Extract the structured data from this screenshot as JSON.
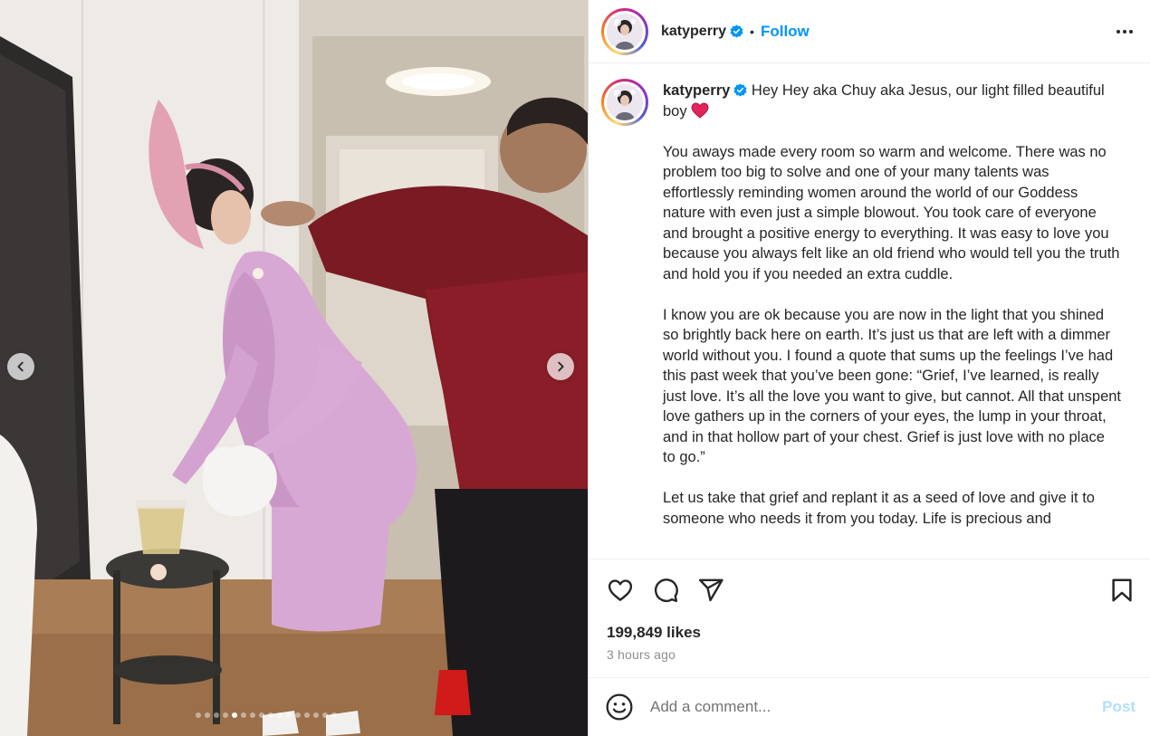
{
  "post": {
    "username": "katyperry",
    "verified": true,
    "separator": "•",
    "follow_label": "Follow",
    "more_icon": "more-horizontal-icon"
  },
  "media": {
    "prev_icon": "chevron-left-icon",
    "next_icon": "chevron-right-icon",
    "slide_count": 16,
    "active_slide": 5
  },
  "caption": {
    "username": "katyperry",
    "first_line": "Hey Hey aka Chuy aka Jesus, our light filled beautiful boy",
    "heart_emoji": "red-heart-icon",
    "paragraphs": [
      "You aways made every room so warm and welcome. There was no problem too big to solve and one of your many talents was effortlessly reminding women around the world of our Goddess nature with even just a simple blowout. You took care of everyone and brought a positive energy to everything. It was easy to love you because you always felt like an old friend who would tell you the truth and hold you if you needed an extra cuddle.",
      "I know you are ok because you are now in the light that you shined so brightly back here on earth. It’s just us that are left with a dimmer world without you. I found a quote that sums up the feelings I’ve had this past week that you’ve been gone: “Grief, I’ve learned, is really just love. It’s all the love you want to give, but cannot. All that unspent love gathers up in the corners of your eyes, the lump in your throat, and in that hollow part of your chest. Grief is just love with no place to go.”",
      "Let us take that grief and replant it as a seed of love and give it to someone who needs it from you today. Life is precious and"
    ]
  },
  "actions": {
    "like_icon": "heart-outline-icon",
    "comment_icon": "comment-bubble-icon",
    "share_icon": "paper-plane-icon",
    "save_icon": "bookmark-icon",
    "likes": "199,849 likes",
    "timestamp": "3 hours ago"
  },
  "comment": {
    "emoji_icon": "smiley-face-icon",
    "placeholder": "Add a comment...",
    "post_label": "Post"
  },
  "colors": {
    "accent": "#0095f6",
    "post_disabled": "#b2dffc",
    "verified": "#0095f6",
    "heart": "#e0245e"
  }
}
